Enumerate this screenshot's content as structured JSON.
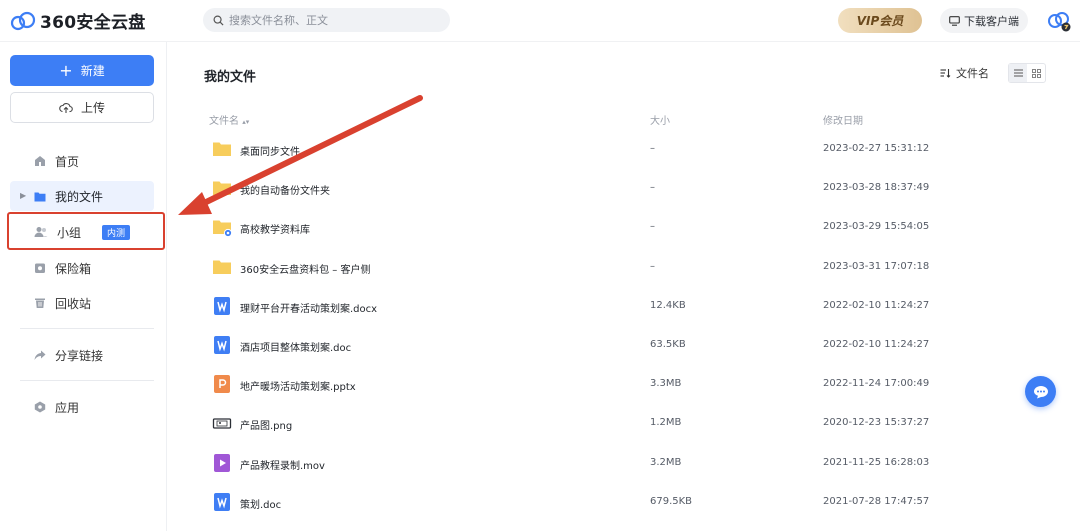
{
  "app": {
    "logo_text": "360安全云盘"
  },
  "header": {
    "search_placeholder": "搜索文件名称、正文",
    "vip_label": "VIP会员",
    "download_label": "下载客户端"
  },
  "sidebar": {
    "new_label": "新建",
    "upload_label": "上传",
    "items": [
      {
        "label": "首页",
        "icon": "home-icon"
      },
      {
        "label": "我的文件",
        "icon": "folder-icon"
      },
      {
        "label": "小组",
        "icon": "group-icon",
        "badge": "内测"
      },
      {
        "label": "保险箱",
        "icon": "safe-icon"
      },
      {
        "label": "回收站",
        "icon": "trash-icon"
      },
      {
        "label": "分享链接",
        "icon": "share-icon"
      },
      {
        "label": "应用",
        "icon": "apps-icon"
      }
    ]
  },
  "main": {
    "title": "我的文件",
    "sort_label": "文件名",
    "columns": {
      "name": "文件名",
      "size": "大小",
      "date": "修改日期"
    },
    "files": [
      {
        "name": "桌面同步文件",
        "size": "–",
        "date": "2023-02-27 15:31:12",
        "type": "folder"
      },
      {
        "name": "我的自动备份文件夹",
        "size": "–",
        "date": "2023-03-28 18:37:49",
        "type": "folder"
      },
      {
        "name": "高校教学资料库",
        "size": "–",
        "date": "2023-03-29 15:54:05",
        "type": "folder-shared"
      },
      {
        "name": "360安全云盘资料包 – 客户侧",
        "size": "–",
        "date": "2023-03-31 17:07:18",
        "type": "folder"
      },
      {
        "name": "理财平台开春活动策划案.docx",
        "size": "12.4KB",
        "date": "2022-02-10 11:24:27",
        "type": "word"
      },
      {
        "name": "酒店项目整体策划案.doc",
        "size": "63.5KB",
        "date": "2022-02-10 11:24:27",
        "type": "word"
      },
      {
        "name": "地产暖场活动策划案.pptx",
        "size": "3.3MB",
        "date": "2022-11-24 17:00:49",
        "type": "ppt"
      },
      {
        "name": "产品图.png",
        "size": "1.2MB",
        "date": "2020-12-23 15:37:27",
        "type": "image"
      },
      {
        "name": "产品教程录制.mov",
        "size": "3.2MB",
        "date": "2021-11-25 16:28:03",
        "type": "video"
      },
      {
        "name": "策划.doc",
        "size": "679.5KB",
        "date": "2021-07-28 17:47:57",
        "type": "word"
      }
    ]
  },
  "colors": {
    "accent": "#3d7ef5",
    "folder": "#f7cd5c",
    "word": "#3f7ef4",
    "ppt": "#f08a4b",
    "video": "#a057d6",
    "annotation": "#d9412f"
  }
}
